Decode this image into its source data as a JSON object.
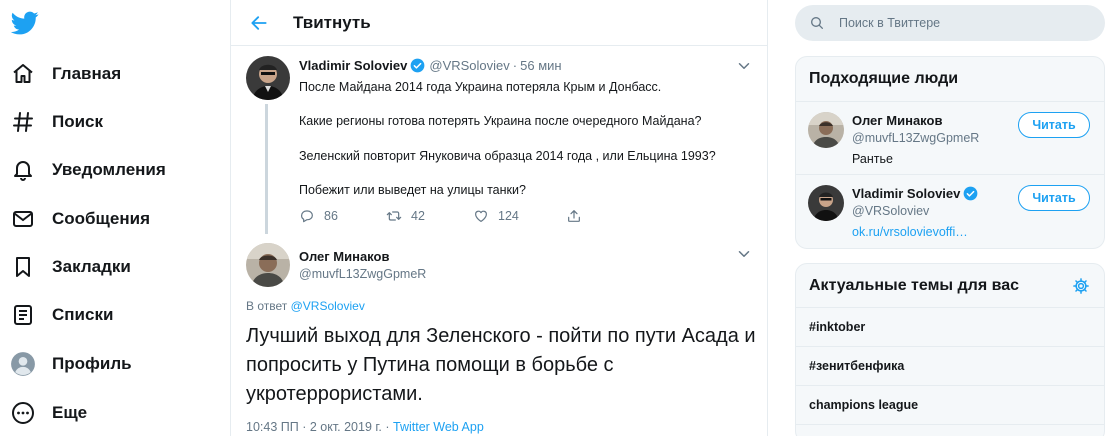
{
  "nav": {
    "logo_icon": "twitter-bird-icon",
    "items": [
      {
        "label": "Главная",
        "icon": "home-icon"
      },
      {
        "label": "Поиск",
        "icon": "hashtag-icon"
      },
      {
        "label": "Уведомления",
        "icon": "bell-icon"
      },
      {
        "label": "Сообщения",
        "icon": "mail-icon"
      },
      {
        "label": "Закладки",
        "icon": "bookmark-icon"
      },
      {
        "label": "Списки",
        "icon": "list-icon"
      },
      {
        "label": "Профиль",
        "icon": "profile-icon"
      },
      {
        "label": "Еще",
        "icon": "more-icon"
      }
    ]
  },
  "header": {
    "title": "Твитнуть"
  },
  "tweet1": {
    "name": "Vladimir Soloviev",
    "handle": "@VRSoloviev",
    "dot": "·",
    "time": "56 мин",
    "lines": [
      "После  Майдана 2014 года Украина потеряла Крым и Донбасс.",
      "Какие регионы готова  потерять Украина после очередного Майдана?",
      "Зеленский повторит Януковича образца 2014 года , или Ельцина 1993?",
      "Побежит или выведет на улицы танки?"
    ],
    "replies": "86",
    "retweets": "42",
    "likes": "124"
  },
  "tweet2": {
    "name": "Олег Минаков",
    "handle": "@muvfL13ZwgGpmeR",
    "reply_prefix": "В ответ",
    "reply_to": "@VRSoloviev",
    "text": "Лучший выход для Зеленского - пойти по пути Асада и попросить у Путина помощи в борьбе с укротеррористами.",
    "timestamp": "10:43 ПП · 2 окт. 2019 г. · ",
    "source": "Twitter Web App"
  },
  "search": {
    "placeholder": "Поиск в Твиттере"
  },
  "who_to_follow": {
    "title": "Подходящие люди",
    "users": [
      {
        "name": "Олег Минаков",
        "handle": "@muvfL13ZwgGpmeR",
        "bio": "Рантье",
        "button": "Читать"
      },
      {
        "name": "Vladimir Soloviev",
        "handle": "@VRSoloviev",
        "bio": "ok.ru/vrsolovievoffi…",
        "button": "Читать"
      }
    ]
  },
  "trends": {
    "title": "Актуальные темы для вас",
    "items": [
      "#inktober",
      "#зенитбенфика",
      "champions league"
    ]
  },
  "colors": {
    "accent": "#1da1f2",
    "text": "#14171a",
    "muted": "#657786",
    "border": "#e6ecf0"
  }
}
